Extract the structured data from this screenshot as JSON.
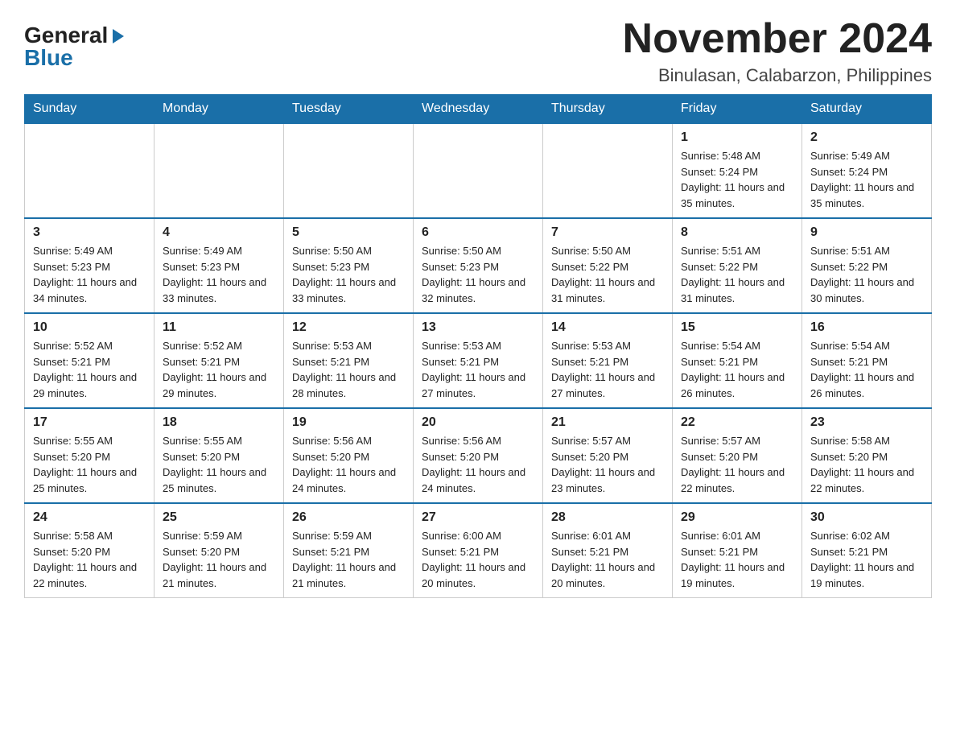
{
  "logo": {
    "general": "General",
    "blue": "Blue"
  },
  "title": {
    "month_year": "November 2024",
    "location": "Binulasan, Calabarzon, Philippines"
  },
  "weekdays": [
    "Sunday",
    "Monday",
    "Tuesday",
    "Wednesday",
    "Thursday",
    "Friday",
    "Saturday"
  ],
  "weeks": [
    [
      {
        "day": "",
        "info": ""
      },
      {
        "day": "",
        "info": ""
      },
      {
        "day": "",
        "info": ""
      },
      {
        "day": "",
        "info": ""
      },
      {
        "day": "",
        "info": ""
      },
      {
        "day": "1",
        "info": "Sunrise: 5:48 AM\nSunset: 5:24 PM\nDaylight: 11 hours and 35 minutes."
      },
      {
        "day": "2",
        "info": "Sunrise: 5:49 AM\nSunset: 5:24 PM\nDaylight: 11 hours and 35 minutes."
      }
    ],
    [
      {
        "day": "3",
        "info": "Sunrise: 5:49 AM\nSunset: 5:23 PM\nDaylight: 11 hours and 34 minutes."
      },
      {
        "day": "4",
        "info": "Sunrise: 5:49 AM\nSunset: 5:23 PM\nDaylight: 11 hours and 33 minutes."
      },
      {
        "day": "5",
        "info": "Sunrise: 5:50 AM\nSunset: 5:23 PM\nDaylight: 11 hours and 33 minutes."
      },
      {
        "day": "6",
        "info": "Sunrise: 5:50 AM\nSunset: 5:23 PM\nDaylight: 11 hours and 32 minutes."
      },
      {
        "day": "7",
        "info": "Sunrise: 5:50 AM\nSunset: 5:22 PM\nDaylight: 11 hours and 31 minutes."
      },
      {
        "day": "8",
        "info": "Sunrise: 5:51 AM\nSunset: 5:22 PM\nDaylight: 11 hours and 31 minutes."
      },
      {
        "day": "9",
        "info": "Sunrise: 5:51 AM\nSunset: 5:22 PM\nDaylight: 11 hours and 30 minutes."
      }
    ],
    [
      {
        "day": "10",
        "info": "Sunrise: 5:52 AM\nSunset: 5:21 PM\nDaylight: 11 hours and 29 minutes."
      },
      {
        "day": "11",
        "info": "Sunrise: 5:52 AM\nSunset: 5:21 PM\nDaylight: 11 hours and 29 minutes."
      },
      {
        "day": "12",
        "info": "Sunrise: 5:53 AM\nSunset: 5:21 PM\nDaylight: 11 hours and 28 minutes."
      },
      {
        "day": "13",
        "info": "Sunrise: 5:53 AM\nSunset: 5:21 PM\nDaylight: 11 hours and 27 minutes."
      },
      {
        "day": "14",
        "info": "Sunrise: 5:53 AM\nSunset: 5:21 PM\nDaylight: 11 hours and 27 minutes."
      },
      {
        "day": "15",
        "info": "Sunrise: 5:54 AM\nSunset: 5:21 PM\nDaylight: 11 hours and 26 minutes."
      },
      {
        "day": "16",
        "info": "Sunrise: 5:54 AM\nSunset: 5:21 PM\nDaylight: 11 hours and 26 minutes."
      }
    ],
    [
      {
        "day": "17",
        "info": "Sunrise: 5:55 AM\nSunset: 5:20 PM\nDaylight: 11 hours and 25 minutes."
      },
      {
        "day": "18",
        "info": "Sunrise: 5:55 AM\nSunset: 5:20 PM\nDaylight: 11 hours and 25 minutes."
      },
      {
        "day": "19",
        "info": "Sunrise: 5:56 AM\nSunset: 5:20 PM\nDaylight: 11 hours and 24 minutes."
      },
      {
        "day": "20",
        "info": "Sunrise: 5:56 AM\nSunset: 5:20 PM\nDaylight: 11 hours and 24 minutes."
      },
      {
        "day": "21",
        "info": "Sunrise: 5:57 AM\nSunset: 5:20 PM\nDaylight: 11 hours and 23 minutes."
      },
      {
        "day": "22",
        "info": "Sunrise: 5:57 AM\nSunset: 5:20 PM\nDaylight: 11 hours and 22 minutes."
      },
      {
        "day": "23",
        "info": "Sunrise: 5:58 AM\nSunset: 5:20 PM\nDaylight: 11 hours and 22 minutes."
      }
    ],
    [
      {
        "day": "24",
        "info": "Sunrise: 5:58 AM\nSunset: 5:20 PM\nDaylight: 11 hours and 22 minutes."
      },
      {
        "day": "25",
        "info": "Sunrise: 5:59 AM\nSunset: 5:20 PM\nDaylight: 11 hours and 21 minutes."
      },
      {
        "day": "26",
        "info": "Sunrise: 5:59 AM\nSunset: 5:21 PM\nDaylight: 11 hours and 21 minutes."
      },
      {
        "day": "27",
        "info": "Sunrise: 6:00 AM\nSunset: 5:21 PM\nDaylight: 11 hours and 20 minutes."
      },
      {
        "day": "28",
        "info": "Sunrise: 6:01 AM\nSunset: 5:21 PM\nDaylight: 11 hours and 20 minutes."
      },
      {
        "day": "29",
        "info": "Sunrise: 6:01 AM\nSunset: 5:21 PM\nDaylight: 11 hours and 19 minutes."
      },
      {
        "day": "30",
        "info": "Sunrise: 6:02 AM\nSunset: 5:21 PM\nDaylight: 11 hours and 19 minutes."
      }
    ]
  ]
}
